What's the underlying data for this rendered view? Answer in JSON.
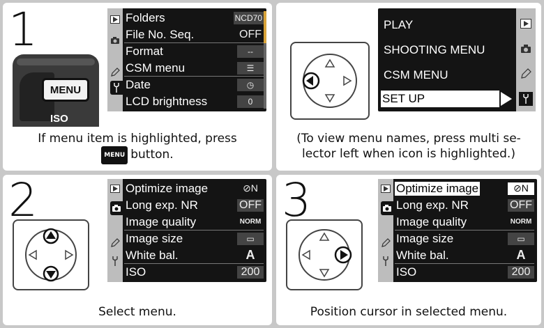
{
  "steps": {
    "one": "1",
    "two": "2",
    "three": "3"
  },
  "captions": {
    "step1_line1": "If menu item is highlighted, press",
    "step1_line2": "button.",
    "step1_btn": "MENU",
    "step1b_line1": "(To view menu names, press multi se-",
    "step1b_line2": "lector left when icon is highlighted.)",
    "step2": "Select menu.",
    "step3": "Position cursor in selected menu."
  },
  "camera": {
    "menu_label": "MENU",
    "iso_label": "ISO"
  },
  "setup_menu": {
    "rows": [
      {
        "label": "Folders",
        "value": "NCD70"
      },
      {
        "label": "File No. Seq.",
        "value": "OFF"
      },
      {
        "label": "Format",
        "value": "--"
      },
      {
        "label": "CSM menu",
        "value": "☰"
      },
      {
        "label": "Date",
        "value": "◷"
      },
      {
        "label": "LCD brightness",
        "value": "0"
      }
    ]
  },
  "menu_names": {
    "rows": [
      {
        "label": "PLAY"
      },
      {
        "label": "SHOOTING MENU"
      },
      {
        "label": "CSM MENU"
      },
      {
        "label": "SET UP"
      }
    ]
  },
  "shooting_menu": {
    "rows": [
      {
        "label": "Optimize image",
        "value": "⊘N"
      },
      {
        "label": "Long exp. NR",
        "value": "OFF"
      },
      {
        "label": "Image quality",
        "value": "NORM"
      },
      {
        "label": "Image size",
        "value": "▭"
      },
      {
        "label": "White bal.",
        "value": "A"
      },
      {
        "label": "ISO",
        "value": "200"
      }
    ]
  },
  "colors": {
    "background": "#c8c8c8",
    "lcd": "#141414",
    "accent": "#d9a43a"
  }
}
